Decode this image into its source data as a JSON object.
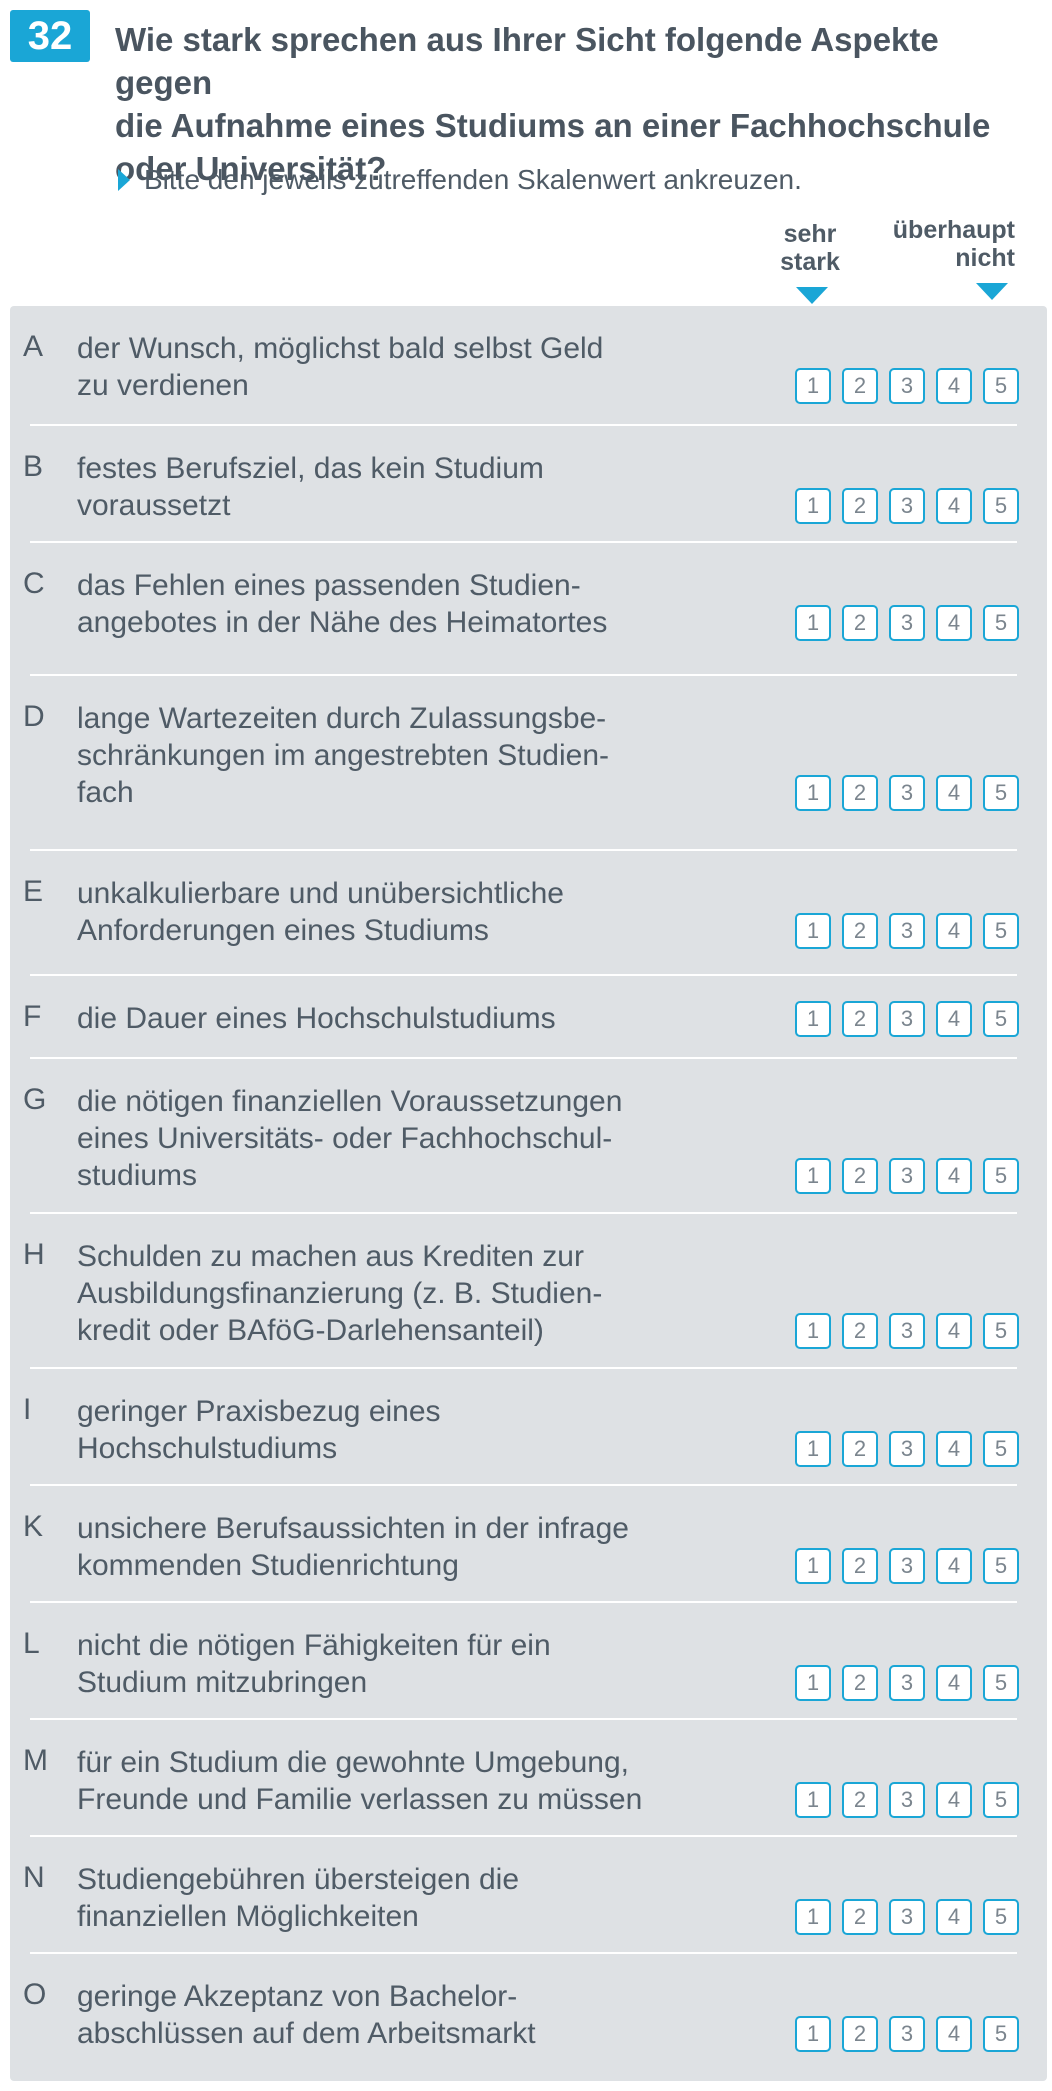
{
  "question": {
    "number": "32",
    "title": "Wie stark sprechen aus Ihrer Sicht folgende Aspekte gegen\ndie Aufnahme eines Studiums an einer Fachhochschule\noder Universität?",
    "instruction": "Bitte den jeweils zutreffenden Skalenwert ankreuzen.",
    "scale_left": "sehr\nstark",
    "scale_right": "überhaupt\nnicht",
    "scale_values": [
      "1",
      "2",
      "3",
      "4",
      "5"
    ]
  },
  "colors": {
    "accent": "#1aa6d6",
    "panel": "#dee1e4",
    "text": "#4f5b66"
  },
  "items": [
    {
      "letter": "A",
      "text": "der Wunsch, möglichst bald selbst Geld\nzu verdienen"
    },
    {
      "letter": "B",
      "text": "festes Berufsziel, das kein Studium\nvoraussetzt"
    },
    {
      "letter": "C",
      "text": "das Fehlen eines passenden Studien-\nangebotes in der Nähe des Heimatortes"
    },
    {
      "letter": "D",
      "text": "lange Wartezeiten durch Zulassungsbe-\nschränkungen im angestrebten Studien-\nfach"
    },
    {
      "letter": "E",
      "text": "unkalkulierbare und unübersichtliche\nAnforderungen eines Studiums"
    },
    {
      "letter": "F",
      "text": "die Dauer eines Hochschulstudiums"
    },
    {
      "letter": "G",
      "text": "die nötigen finanziellen Voraussetzungen\neines Universitäts- oder Fachhochschul-\nstudiums"
    },
    {
      "letter": "H",
      "text": "Schulden zu machen aus Krediten zur\nAusbildungsfinanzierung (z. B. Studien-\nkredit oder BAföG-Darlehensanteil)"
    },
    {
      "letter": "I",
      "text": "geringer Praxisbezug eines\nHochschulstudiums"
    },
    {
      "letter": "K",
      "text": "unsichere Berufsaussichten in der infrage\nkommenden Studienrichtung"
    },
    {
      "letter": "L",
      "text": "nicht die nötigen Fähigkeiten für ein\nStudium mitzubringen"
    },
    {
      "letter": "M",
      "text": "für ein Studium die gewohnte Umgebung,\nFreunde und Familie verlassen zu müssen"
    },
    {
      "letter": "N",
      "text": "Studiengebühren übersteigen die\nfinanziellen Möglichkeiten"
    },
    {
      "letter": "O",
      "text": "geringe Akzeptanz von Bachelor-\nabschlüssen auf dem Arbeitsmarkt"
    }
  ]
}
